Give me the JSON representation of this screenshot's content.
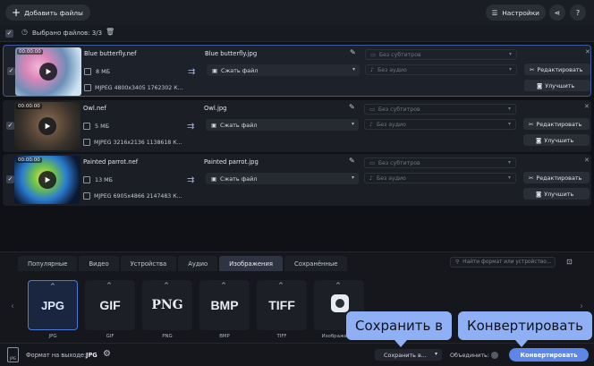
{
  "toolbar": {
    "add_files": "Добавить файлы",
    "settings": "Настройки"
  },
  "selection": {
    "text": "Выбрано файлов: 3/3"
  },
  "files": [
    {
      "duration": "00:00:00",
      "source_name": "Blue butterfly.nef",
      "size": "8 МБ",
      "meta": "MJPEG 4800x3405 1762302 К...",
      "output_name": "Blue butterfly.jpg",
      "compress": "Сжать файл",
      "subtitles": "Без субтитров",
      "audio": "Без аудио",
      "edit": "Редактировать",
      "enhance": "Улучшить"
    },
    {
      "duration": "00:00:00",
      "source_name": "Owl.nef",
      "size": "5 МБ",
      "meta": "MJPEG 3216x2136 1138618 К...",
      "output_name": "Owl.jpg",
      "compress": "Сжать файл",
      "subtitles": "Без субтитров",
      "audio": "Без аудио",
      "edit": "Редактировать",
      "enhance": "Улучшить"
    },
    {
      "duration": "00:00:00",
      "source_name": "Painted parrot.nef",
      "size": "13 МБ",
      "meta": "MJPEG 6905x4866 2147483 К...",
      "output_name": "Painted parrot.jpg",
      "compress": "Сжать файл",
      "subtitles": "Без субтитров",
      "audio": "Без аудио",
      "edit": "Редактировать",
      "enhance": "Улучшить"
    }
  ],
  "tabs": [
    "Популярные",
    "Видео",
    "Устройства",
    "Аудио",
    "Изображения",
    "Сохранённые"
  ],
  "active_tab": "Изображения",
  "search_placeholder": "Найти формат или устройство...",
  "formats": [
    {
      "logo": "JPG",
      "label": "JPG"
    },
    {
      "logo": "GIF",
      "label": "GIF"
    },
    {
      "logo": "PNG",
      "label": "PNG"
    },
    {
      "logo": "BMP",
      "label": "BMP"
    },
    {
      "logo": "TIFF",
      "label": "TIFF"
    },
    {
      "logo": "",
      "label": "Изображения"
    }
  ],
  "bottom": {
    "output_label": "Формат на выходе:",
    "output_value": "JPG",
    "save_in": "Сохранить в...",
    "merge": "Объединить:",
    "convert": "Конвертировать",
    "doc_icon_text": "JPG"
  },
  "callouts": {
    "save": "Сохранить в",
    "convert": "Конвертировать"
  },
  "colors": {
    "accent": "#5d86e6",
    "callout": "#8fb0f4"
  }
}
